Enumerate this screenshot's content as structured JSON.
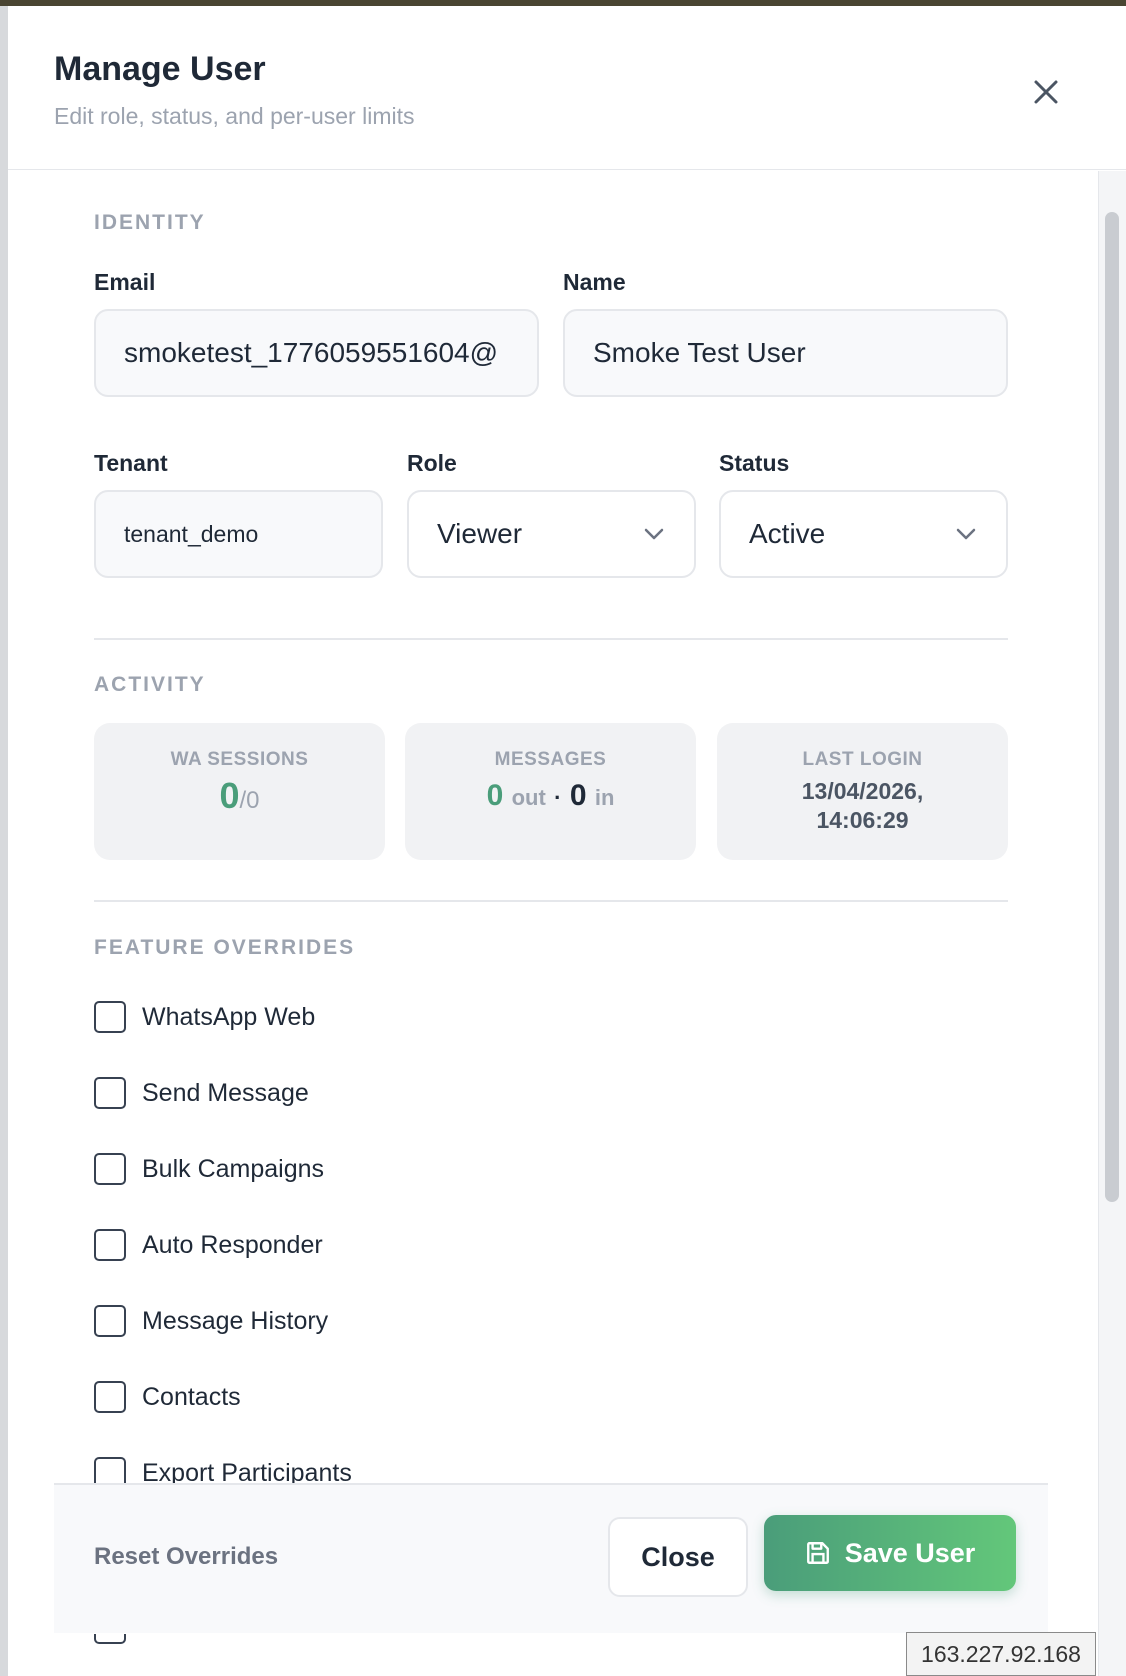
{
  "modal": {
    "title": "Manage User",
    "subtitle": "Edit role, status, and per-user limits"
  },
  "identity": {
    "section_label": "IDENTITY",
    "email_label": "Email",
    "email_value": "smoketest_1776059551604@",
    "name_label": "Name",
    "name_value": "Smoke Test User",
    "tenant_label": "Tenant",
    "tenant_value": "tenant_demo",
    "role_label": "Role",
    "role_value": "Viewer",
    "status_label": "Status",
    "status_value": "Active"
  },
  "activity": {
    "section_label": "ACTIVITY",
    "sessions_label": "WA SESSIONS",
    "sessions_count": "0",
    "sessions_total": "/0",
    "messages_label": "MESSAGES",
    "messages_out": "0",
    "messages_out_suffix": "out",
    "messages_sep": "·",
    "messages_in": "0",
    "messages_in_suffix": "in",
    "last_login_label": "LAST LOGIN",
    "last_login_date": "13/04/2026,",
    "last_login_time": "14:06:29"
  },
  "features": {
    "section_label": "FEATURE OVERRIDES",
    "items": [
      {
        "label": "WhatsApp Web",
        "checked": false
      },
      {
        "label": "Send Message",
        "checked": false
      },
      {
        "label": "Bulk Campaigns",
        "checked": false
      },
      {
        "label": "Auto Responder",
        "checked": false
      },
      {
        "label": "Message History",
        "checked": false
      },
      {
        "label": "Contacts",
        "checked": false
      },
      {
        "label": "Export Participants",
        "checked": false
      }
    ]
  },
  "footer": {
    "reset_label": "Reset Overrides",
    "close_label": "Close",
    "save_label": "Save User"
  },
  "ip_badge": "163.227.92.168",
  "colors": {
    "accent_green": "#4a9d7a",
    "accent_green_light": "#63c77a"
  },
  "icons": {
    "close": "close-icon",
    "chevron": "chevron-down-icon",
    "save": "floppy-disk-icon"
  }
}
